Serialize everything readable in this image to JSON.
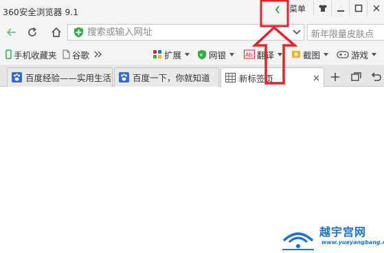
{
  "titlebar": {
    "title": "360安全浏览器 9.1",
    "menu_label": "菜单"
  },
  "addressbar": {
    "url_placeholder": "搜索或输入网址",
    "search_text": "新年限量皮肤点"
  },
  "bookmarks": {
    "items": [
      {
        "label": "手机收藏夹",
        "icon": "phone-icon"
      },
      {
        "label": "谷歌",
        "icon": "page-icon"
      }
    ],
    "tools": [
      {
        "label": "扩展",
        "icon": "extension-icon"
      },
      {
        "label": "网银",
        "icon": "bank-shield-icon"
      },
      {
        "label": "翻译",
        "icon": "translate-icon"
      },
      {
        "label": "截图",
        "icon": "scissors-icon"
      },
      {
        "label": "游戏",
        "icon": "gamepad-icon"
      }
    ]
  },
  "tabs": [
    {
      "title": "百度经验——实用生活",
      "icon": "baidu-paw-icon",
      "active": false
    },
    {
      "title": "百度一下，你就知道",
      "icon": "baidu-paw-icon",
      "active": false
    },
    {
      "title": "新标签页",
      "icon": "grid-icon",
      "active": true
    }
  ],
  "watermark": {
    "name": "越宇宫网",
    "url": "www.yueyangbang.com"
  },
  "colors": {
    "chrome_bg": "#f3f3f3",
    "tabstrip_bg": "#e6e6e6",
    "annotation_red": "#e8202a",
    "green_accent": "#2fae45",
    "baidu_blue": "#2e6bd8",
    "watermark_blue": "#1a73c8"
  }
}
